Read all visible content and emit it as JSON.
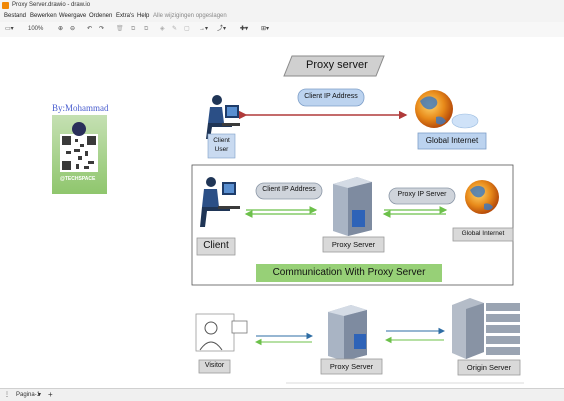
{
  "window": {
    "title": "Proxy Server.drawio - draw.io"
  },
  "menu": {
    "items": [
      "Bestand",
      "Bewerken",
      "Weergave",
      "Ordenen",
      "Extra's",
      "Help"
    ],
    "status": "Alle wijzigingen opgeslagen"
  },
  "toolbar": {
    "zoom": "100%"
  },
  "diagram": {
    "title": "Proxy server",
    "author": "By:Mohammad",
    "qr_caption": "@TECHSPACE",
    "top": {
      "client_label": "Client\nUser",
      "ip_label": "Client IP Address",
      "internet_label": "Global Internet"
    },
    "middle": {
      "client_label": "Client",
      "client_ip": "Client IP Address",
      "proxy_label": "Proxy Server",
      "proxy_ip": "Proxy IP Server",
      "internet_label": "Global Internet",
      "caption": "Communication With Proxy Server"
    },
    "bottom": {
      "visitor_label": "Visitor",
      "proxy_label": "Proxy Server",
      "origin_label": "Origin Server"
    }
  },
  "footer": {
    "page_tab": "Pagina-1"
  },
  "colors": {
    "red_arrow": "#b03a3a",
    "green_arrow": "#6cc04a",
    "blue_arrow": "#2e6da4",
    "caption_bg": "#97d077"
  }
}
